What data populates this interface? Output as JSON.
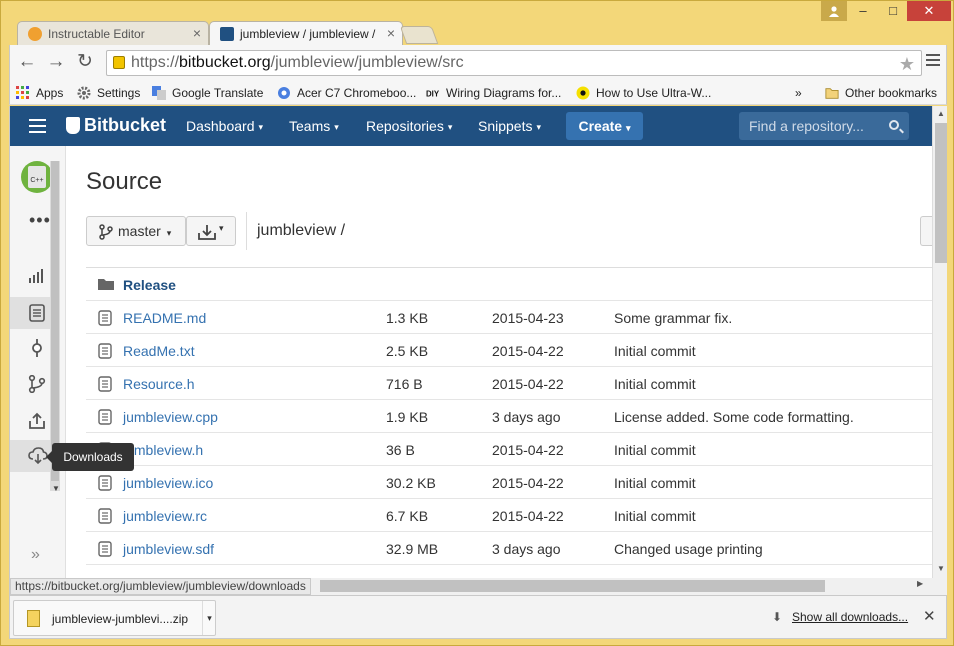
{
  "browser": {
    "tabs": [
      {
        "title": "Instructable Editor",
        "close": "×"
      },
      {
        "title": "jumbleview / jumbleview /",
        "close": "×"
      }
    ],
    "window_controls": {
      "minimize": "–",
      "maximize": "□",
      "close": "✕"
    },
    "nav": {
      "back": "←",
      "forward": "→",
      "reload": "↻"
    },
    "url": {
      "scheme": "https://",
      "host": "bitbucket.org",
      "path": "/jumbleview/jumbleview/src"
    },
    "star": "★",
    "bookmarks": [
      {
        "label": "Apps"
      },
      {
        "label": "Settings"
      },
      {
        "label": "Google Translate"
      },
      {
        "label": "Acer C7 Chromeboo..."
      },
      {
        "label": "Wiring Diagrams for..."
      },
      {
        "label": "How to Use Ultra-W..."
      }
    ],
    "bookmarks_overflow": "»",
    "other_bookmarks": "Other bookmarks"
  },
  "header": {
    "logo": "Bitbucket",
    "nav": [
      "Dashboard",
      "Teams",
      "Repositories",
      "Snippets"
    ],
    "caret": "▾",
    "create": "Create",
    "search_placeholder": "Find a repository..."
  },
  "sidebar": {
    "avatar_text": "C++",
    "more": "•••",
    "tooltip": "Downloads",
    "collapse": "»",
    "scroll_down": "▼"
  },
  "main": {
    "title": "Source",
    "branch": "master",
    "caret": "▾",
    "breadcrumb": "jumbleview /",
    "files": [
      {
        "name": "Release",
        "type": "folder",
        "size": "",
        "date": "",
        "message": ""
      },
      {
        "name": "README.md",
        "type": "file",
        "size": "1.3 KB",
        "date": "2015-04-23",
        "message": "Some grammar fix."
      },
      {
        "name": "ReadMe.txt",
        "type": "file",
        "size": "2.5 KB",
        "date": "2015-04-22",
        "message": "Initial commit"
      },
      {
        "name": "Resource.h",
        "type": "file",
        "size": "716 B",
        "date": "2015-04-22",
        "message": "Initial commit"
      },
      {
        "name": "jumbleview.cpp",
        "type": "file",
        "size": "1.9 KB",
        "date": "3 days ago",
        "message": "License added. Some code formatting."
      },
      {
        "name": "jumbleview.h",
        "type": "file",
        "size": "36 B",
        "date": "2015-04-22",
        "message": "Initial commit"
      },
      {
        "name": "jumbleview.ico",
        "type": "file",
        "size": "30.2 KB",
        "date": "2015-04-22",
        "message": "Initial commit"
      },
      {
        "name": "jumbleview.rc",
        "type": "file",
        "size": "6.7 KB",
        "date": "2015-04-22",
        "message": "Initial commit"
      },
      {
        "name": "jumbleview.sdf",
        "type": "file",
        "size": "32.9 MB",
        "date": "3 days ago",
        "message": "Changed usage printing"
      }
    ]
  },
  "status_url": "https://bitbucket.org/jumbleview/jumbleview/downloads",
  "scroll_arrows": {
    "up": "▲",
    "down": "▼",
    "right": "▶"
  },
  "download_shelf": {
    "file": "jumbleview-jumblevi....zip",
    "menu": "▾",
    "show_all": "Show all downloads...",
    "show_all_icon": "⬇",
    "close": "✕"
  },
  "colors": {
    "header": "#205081",
    "create": "#3572b0",
    "link": "#3572b0",
    "chrome_frame": "#f3d779"
  }
}
